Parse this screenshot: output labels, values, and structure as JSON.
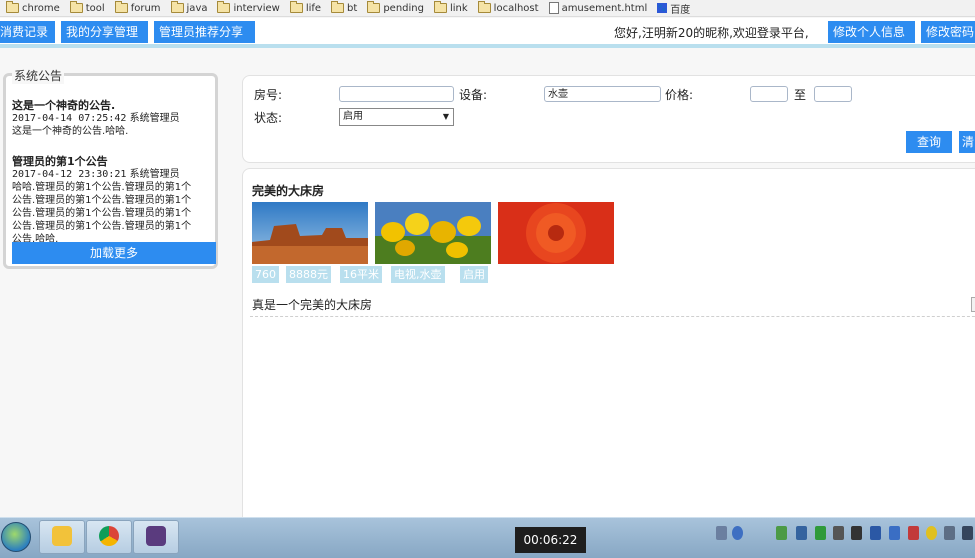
{
  "bookmarks": [
    {
      "type": "folder",
      "label": "chrome"
    },
    {
      "type": "folder",
      "label": "tool"
    },
    {
      "type": "folder",
      "label": "forum"
    },
    {
      "type": "folder",
      "label": "java"
    },
    {
      "type": "folder",
      "label": "interview"
    },
    {
      "type": "folder",
      "label": "life"
    },
    {
      "type": "folder",
      "label": "bt"
    },
    {
      "type": "folder",
      "label": "pending"
    },
    {
      "type": "folder",
      "label": "link"
    },
    {
      "type": "folder",
      "label": "localhost"
    },
    {
      "type": "file",
      "label": "amusement.html"
    },
    {
      "type": "baidu",
      "label": "百度"
    }
  ],
  "nav": {
    "consume_record": "消费记录",
    "my_share": "我的分享管理",
    "admin_recommend": "管理员推荐分享",
    "greeting": "您好,汪明新20的昵称,欢迎登录平台,",
    "edit_profile": "修改个人信息",
    "change_password": "修改密码"
  },
  "notice": {
    "legend": "系统公告",
    "items": [
      {
        "title": "这是一个神奇的公告.",
        "time": "2017-04-14 07:25:42",
        "author": "系统管理员",
        "body": "这是一个神奇的公告.哈哈."
      },
      {
        "title": "管理员的第1个公告",
        "time": "2017-04-12 23:30:21",
        "author": "系统管理员",
        "body_lines": [
          "哈哈.管理员的第1个公告.管理员的第1个",
          "公告.管理员的第1个公告.管理员的第1个",
          "公告.管理员的第1个公告.管理员的第1个",
          "公告.管理员的第1个公告.管理员的第1个",
          "公告.哈哈."
        ]
      }
    ],
    "load_more": "加载更多"
  },
  "search": {
    "room_label": "房号:",
    "room_value": "",
    "device_label": "设备:",
    "device_value": "水壶",
    "price_label": "价格:",
    "price_min": "",
    "price_to": "至",
    "price_max": "",
    "status_label": "状态:",
    "status_value": "启用",
    "query": "查询",
    "reset": "清"
  },
  "room": {
    "title": "完美的大床房",
    "tags": [
      "760",
      "8888元",
      "16平米",
      "电视,水壶",
      "启用"
    ],
    "description": "真是一个完美的大床房"
  },
  "taskbar": {
    "clock": "00:06:22"
  },
  "colors": {
    "accent": "#2d8cf0",
    "tag_bg": "#b9dfee"
  }
}
